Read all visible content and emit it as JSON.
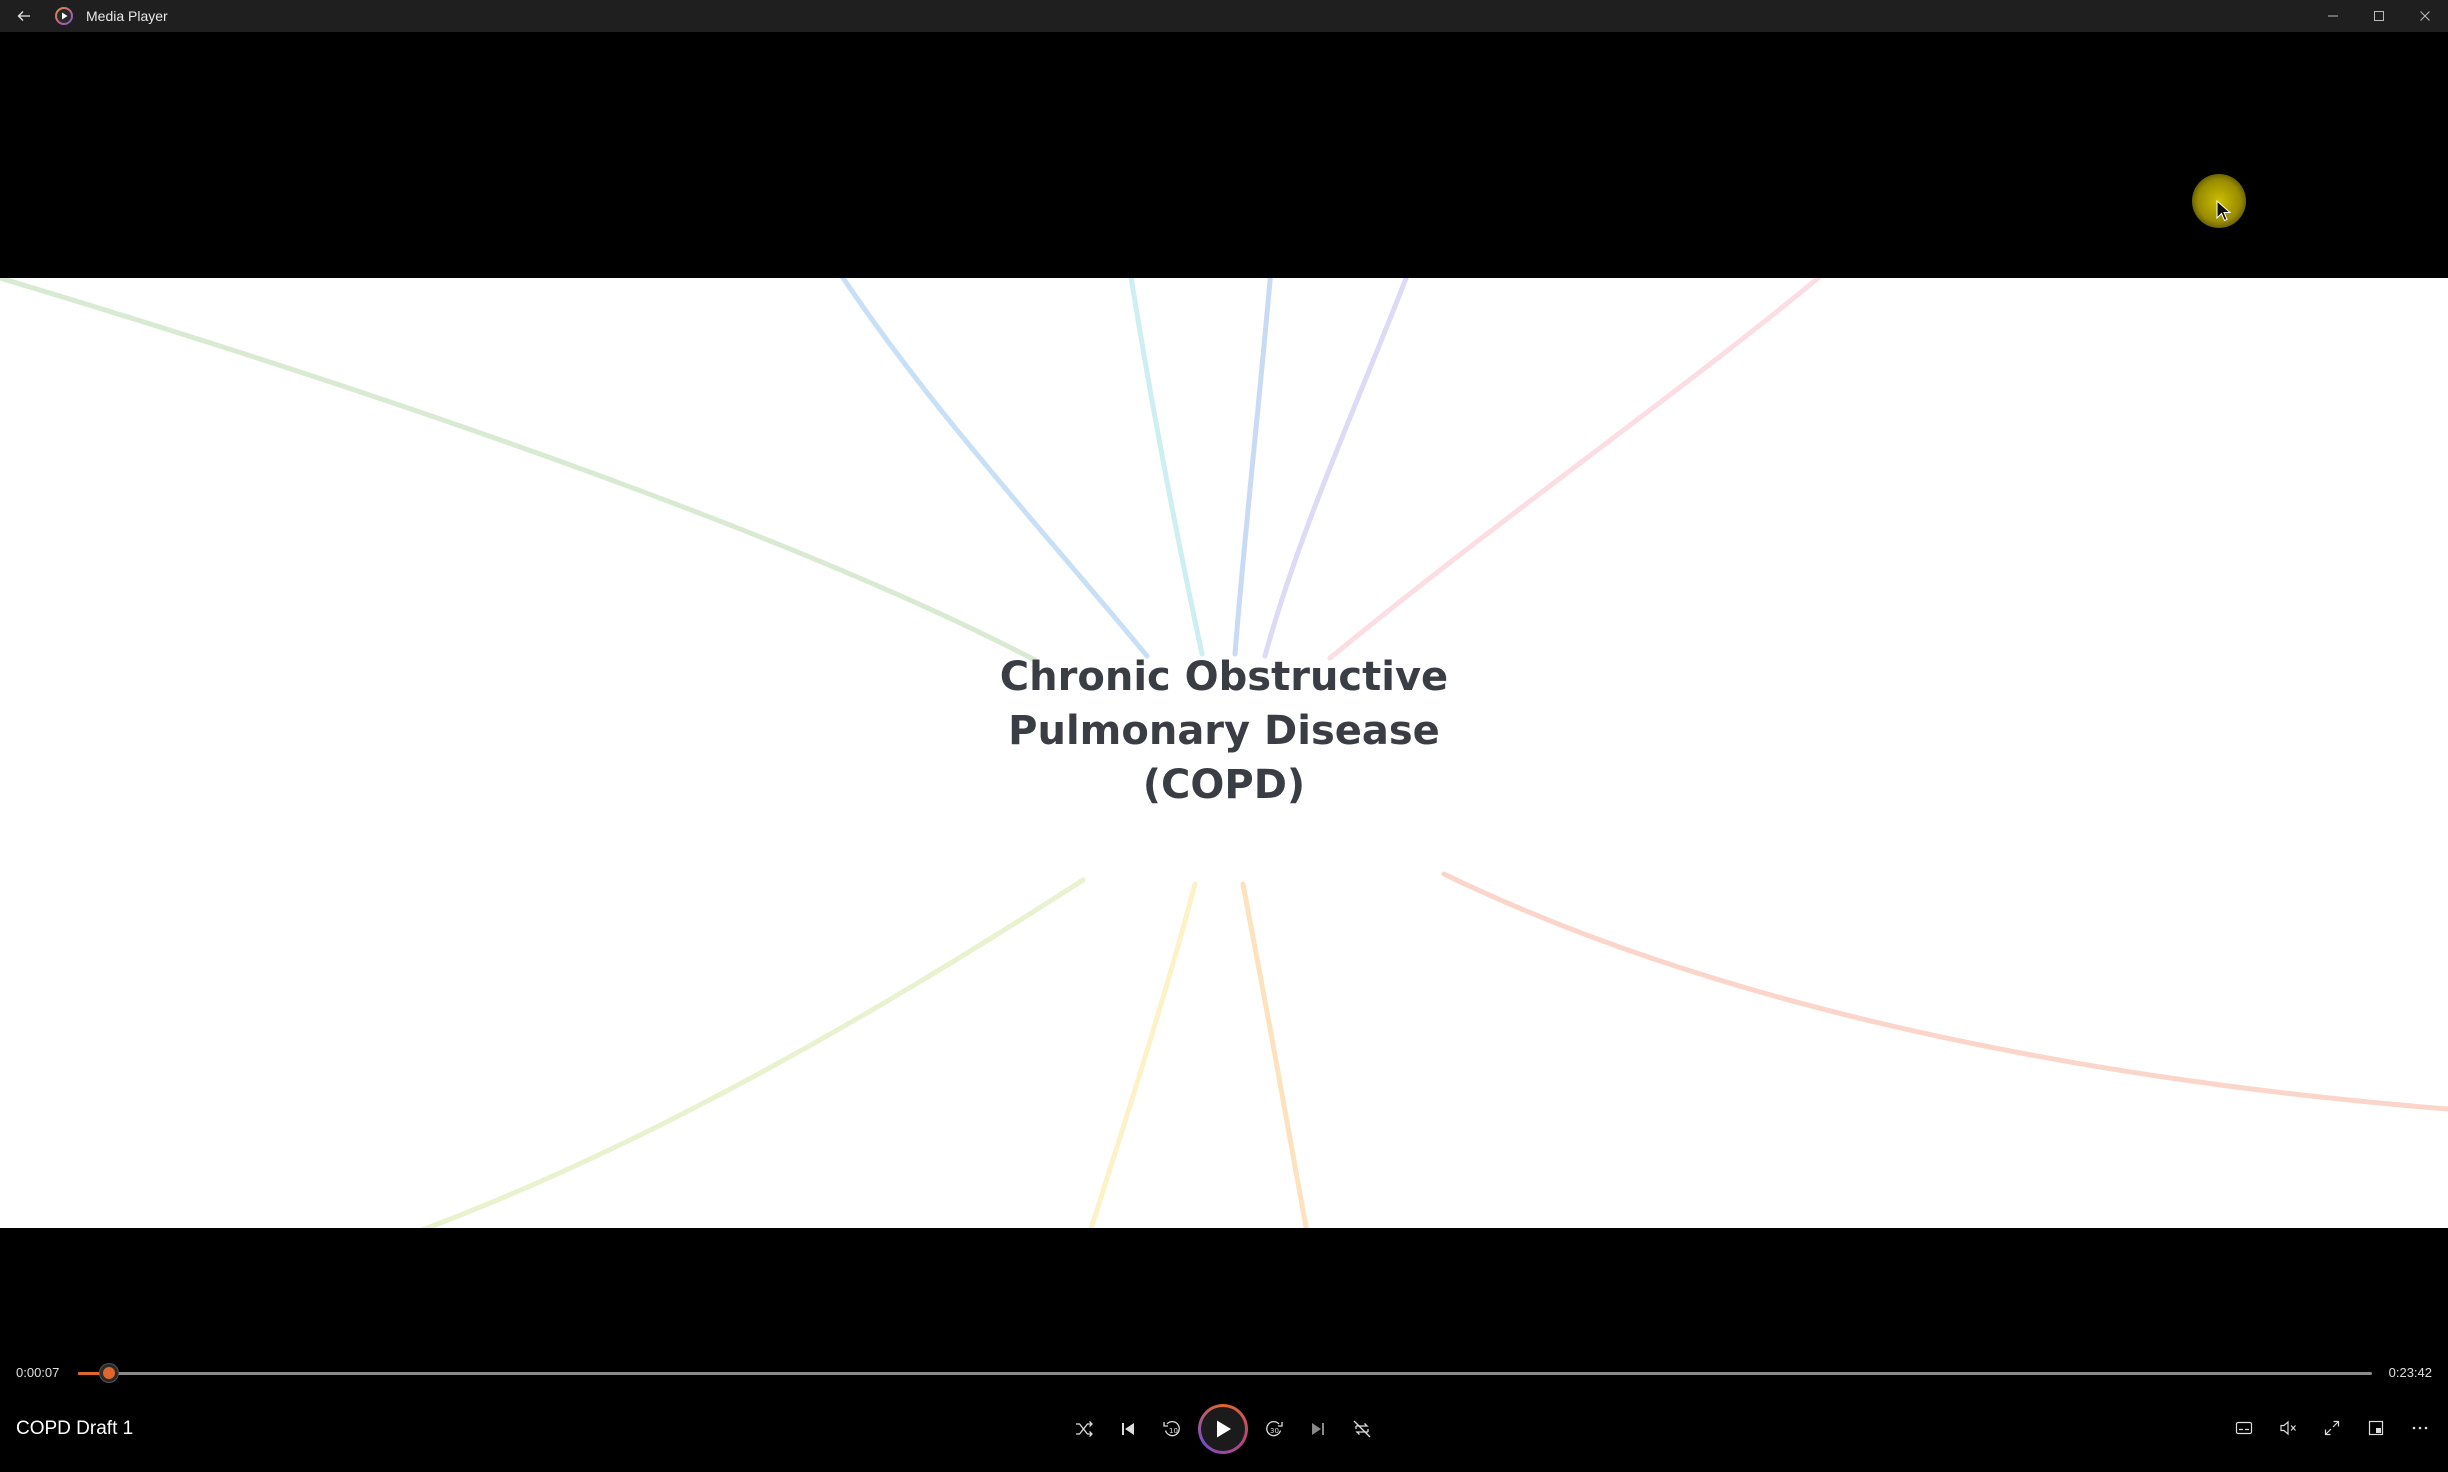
{
  "window": {
    "app_title": "Media Player",
    "icons": {
      "back": "back-arrow-icon",
      "app": "media-player-icon",
      "minimize": "minimize-icon",
      "maximize": "maximize-icon",
      "close": "close-icon"
    }
  },
  "video": {
    "central_topic_lines": [
      "Chronic Obstructive",
      "Pulmonary Disease",
      "(COPD)"
    ],
    "branch_colors": [
      "#d9ead3",
      "#c7e0f7",
      "#cdeef2",
      "#c9daf5",
      "#dcdaf6",
      "#fbdde3",
      "#e9f2cf",
      "#fdf1c8",
      "#fde2bd",
      "#fbd5c9"
    ]
  },
  "controls": {
    "time_current": "0:00:07",
    "time_total": "0:23:42",
    "progress_fraction": 0.005,
    "media_title": "COPD Draft 1",
    "accent_color": "#e0662b",
    "center_buttons": [
      "shuffle-icon",
      "previous-icon",
      "rewind-10-icon",
      "play-icon",
      "forward-30-icon",
      "next-icon",
      "repeat-off-icon"
    ],
    "right_buttons": [
      "subtitles-icon",
      "mute-icon",
      "fullscreen-icon",
      "miniplayer-icon",
      "more-options-icon"
    ]
  }
}
